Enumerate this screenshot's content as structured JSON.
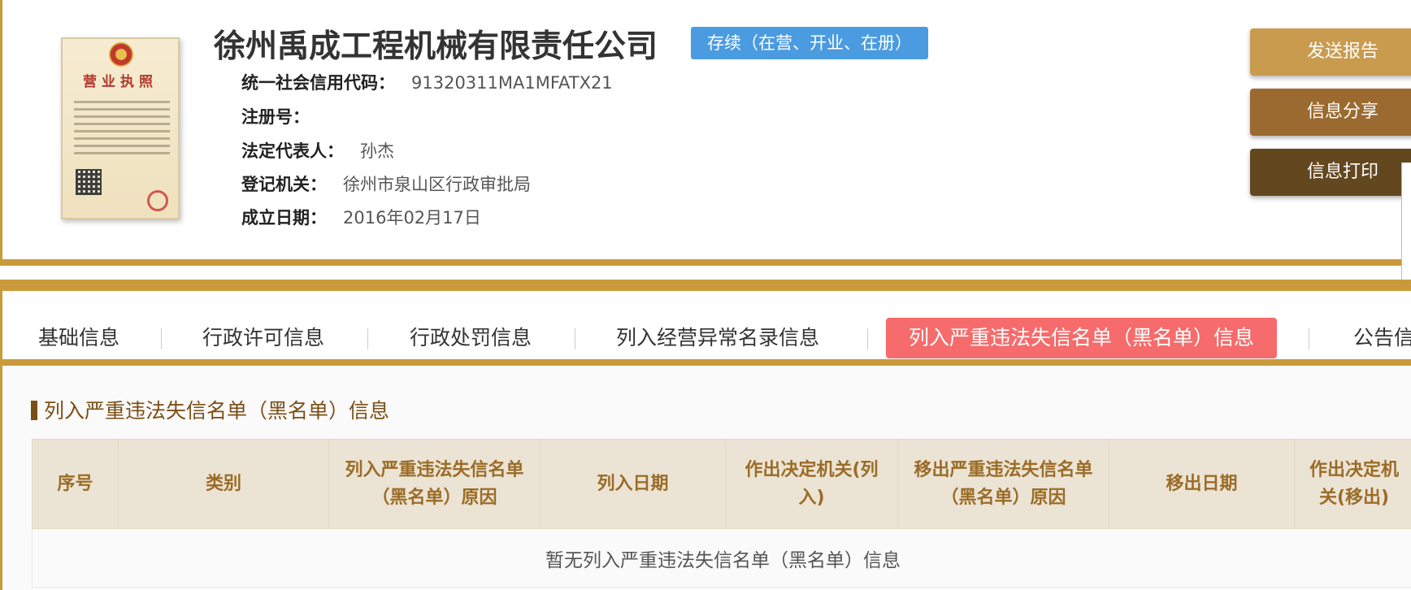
{
  "company": {
    "name": "徐州禹成工程机械有限责任公司",
    "status": "存续（在营、开业、在册）",
    "license_title": "营业执照",
    "fields": [
      {
        "label": "统一社会信用代码：",
        "value": "91320311MA1MFATX21"
      },
      {
        "label": "注册号：",
        "value": ""
      },
      {
        "label": "法定代表人：",
        "value": "孙杰"
      },
      {
        "label": "登记机关：",
        "value": "徐州市泉山区行政审批局"
      },
      {
        "label": "成立日期：",
        "value": "2016年02月17日"
      }
    ]
  },
  "actions": {
    "send_report": "发送报告",
    "share_info": "信息分享",
    "print_info": "信息打印"
  },
  "tabs": [
    {
      "label": "基础信息",
      "active": false
    },
    {
      "label": "行政许可信息",
      "active": false
    },
    {
      "label": "行政处罚信息",
      "active": false
    },
    {
      "label": "列入经营异常名录信息",
      "active": false
    },
    {
      "label": "列入严重违法失信名单（黑名单）信息",
      "active": true
    },
    {
      "label": "公告信",
      "active": false
    }
  ],
  "section": {
    "title": "列入严重违法失信名单（黑名单）信息",
    "columns": [
      "序号",
      "类别",
      "列入严重违法失信名单（黑名单）原因",
      "列入日期",
      "作出决定机关(列入)",
      "移出严重违法失信名单（黑名单）原因",
      "移出日期",
      "作出决定机关(移出)"
    ],
    "empty_text": "暂无列入严重违法失信名单（黑名单）信息"
  },
  "colors": {
    "accent_gold": "#c99a3b",
    "status_blue": "#4a9be0",
    "active_tab_red": "#f66b6b",
    "header_brown": "#7a4f16"
  }
}
